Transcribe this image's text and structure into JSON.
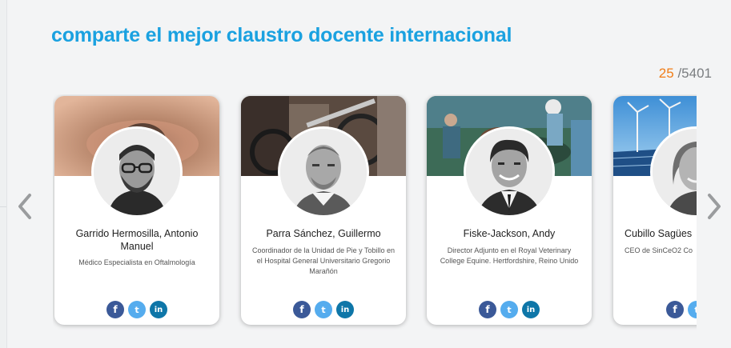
{
  "header": {
    "title_prefix": "comparte el mejor ",
    "title_bold": "claustro docente internacional"
  },
  "pager": {
    "current": "25",
    "total": "/5401"
  },
  "nav": {
    "prev_icon": "chevron-left-icon",
    "next_icon": "chevron-right-icon"
  },
  "teachers": [
    {
      "name": "Garrido Hermosilla, Antonio Manuel",
      "role": "Médico Especialista en Oftalmología"
    },
    {
      "name": "Parra Sánchez, Guillermo",
      "role": "Coordinador de la Unidad de Pie y Tobillo en el Hospital General Universitario Gregorio Marañón"
    },
    {
      "name": "Fiske-Jackson, Andy",
      "role": "Director Adjunto en el Royal Veterinary College Equine. Hertfordshire, Reino Unido"
    },
    {
      "name": "Cubillo Sagües",
      "role": "CEO de SinCeO2 Co"
    }
  ],
  "social": {
    "facebook": "f",
    "twitter": "t",
    "linkedin": "in"
  },
  "colors": {
    "accent": "#1aa1e0",
    "counter_current": "#f07d18",
    "facebook": "#3b5998",
    "twitter": "#55acee",
    "linkedin": "#0e76a8"
  }
}
